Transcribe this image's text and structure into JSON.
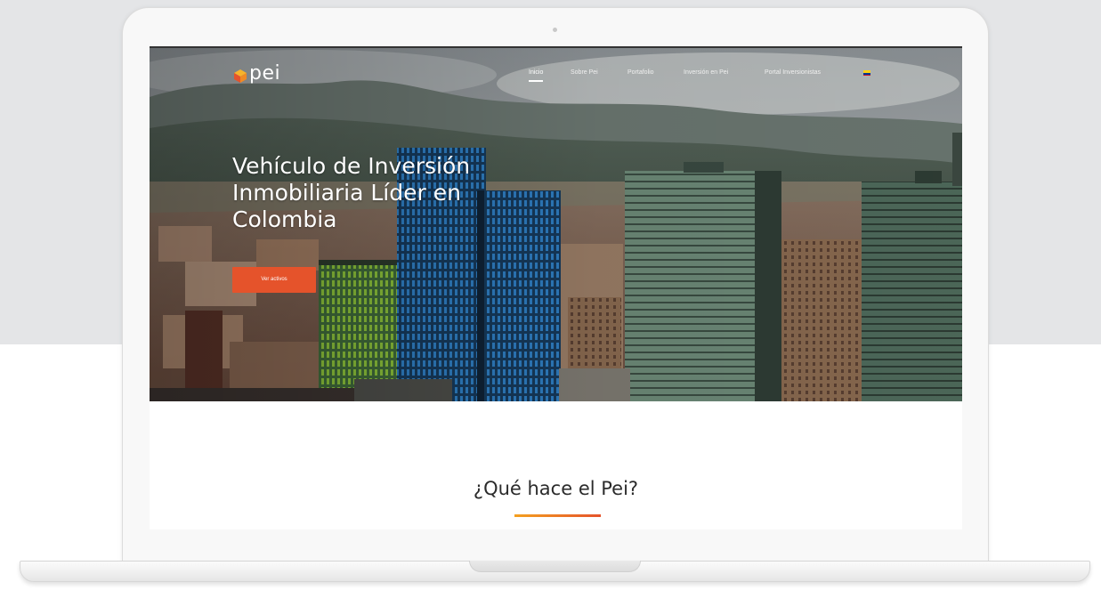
{
  "site": {
    "logo_text": "pei",
    "nav": [
      {
        "label": "Inicio",
        "active": true
      },
      {
        "label": "Sobre Pei",
        "active": false
      },
      {
        "label": "Portafolio",
        "active": false
      },
      {
        "label": "Inversión en Pei",
        "active": false
      },
      {
        "label": "Portal Inversionistas",
        "active": false
      }
    ]
  },
  "hero": {
    "title": "Vehículo de Inversión Inmobiliaria Líder en Colombia",
    "cta_label": "Ver activos"
  },
  "section": {
    "title": "¿Qué hace el Pei?"
  },
  "colors": {
    "accent": "#e5532b",
    "accent_gradient_start": "#f4a020",
    "page_background": "#e4e5e7"
  },
  "icons": {
    "logo": "cube-logo-icon",
    "language": "colombia-flag-icon"
  }
}
